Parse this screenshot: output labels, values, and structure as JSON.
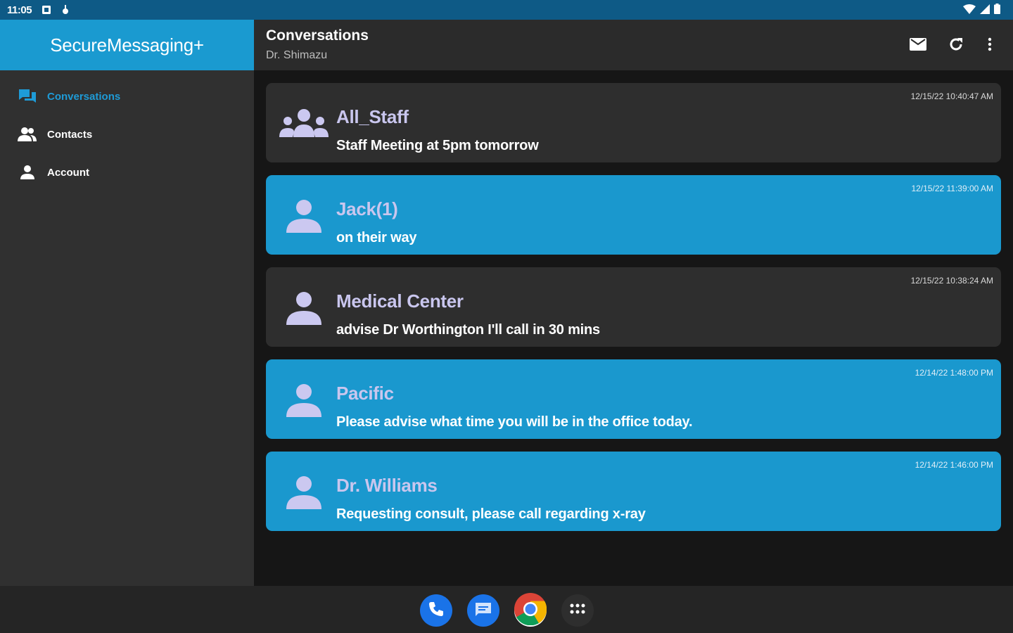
{
  "status_bar": {
    "time": "11:05",
    "icons": [
      "notification-square-icon",
      "debug-icon",
      "wifi-icon",
      "signal-icon",
      "battery-icon"
    ]
  },
  "sidebar": {
    "app_title": "SecureMessaging+",
    "items": [
      {
        "label": "Conversations",
        "icon": "chat-icon",
        "active": true
      },
      {
        "label": "Contacts",
        "icon": "contacts-icon",
        "active": false
      },
      {
        "label": "Account",
        "icon": "person-icon",
        "active": false
      }
    ]
  },
  "header": {
    "title": "Conversations",
    "subtitle": "Dr. Shimazu",
    "actions": [
      "mail-icon",
      "refresh-icon",
      "more-vert-icon"
    ]
  },
  "conversations": [
    {
      "name": "All_Staff",
      "message": "Staff Meeting at 5pm tomorrow",
      "timestamp": "12/15/22 10:40:47 AM",
      "unread": false,
      "group": true
    },
    {
      "name": "Jack(1)",
      "message": "on their way",
      "timestamp": "12/15/22 11:39:00 AM",
      "unread": true,
      "group": false
    },
    {
      "name": "Medical Center",
      "message": "advise Dr  Worthington I'll call in 30 mins",
      "timestamp": "12/15/22 10:38:24 AM",
      "unread": false,
      "group": false
    },
    {
      "name": "Pacific",
      "message": "Please advise what time you will be in the office today.",
      "timestamp": "12/14/22 1:48:00 PM",
      "unread": true,
      "group": false
    },
    {
      "name": "Dr. Williams",
      "message": "Requesting consult, please call regarding x-ray",
      "timestamp": "12/14/22 1:46:00 PM",
      "unread": true,
      "group": false
    }
  ],
  "dock": {
    "apps": [
      "phone-icon",
      "messages-icon",
      "chrome-icon",
      "app-drawer-icon"
    ]
  },
  "colors": {
    "accent": "#1a9ad0",
    "status_bar": "#0e5a86",
    "sidebar_bg": "#303030",
    "card_read": "#2e2e2e",
    "name_text": "#c9c6ee"
  }
}
